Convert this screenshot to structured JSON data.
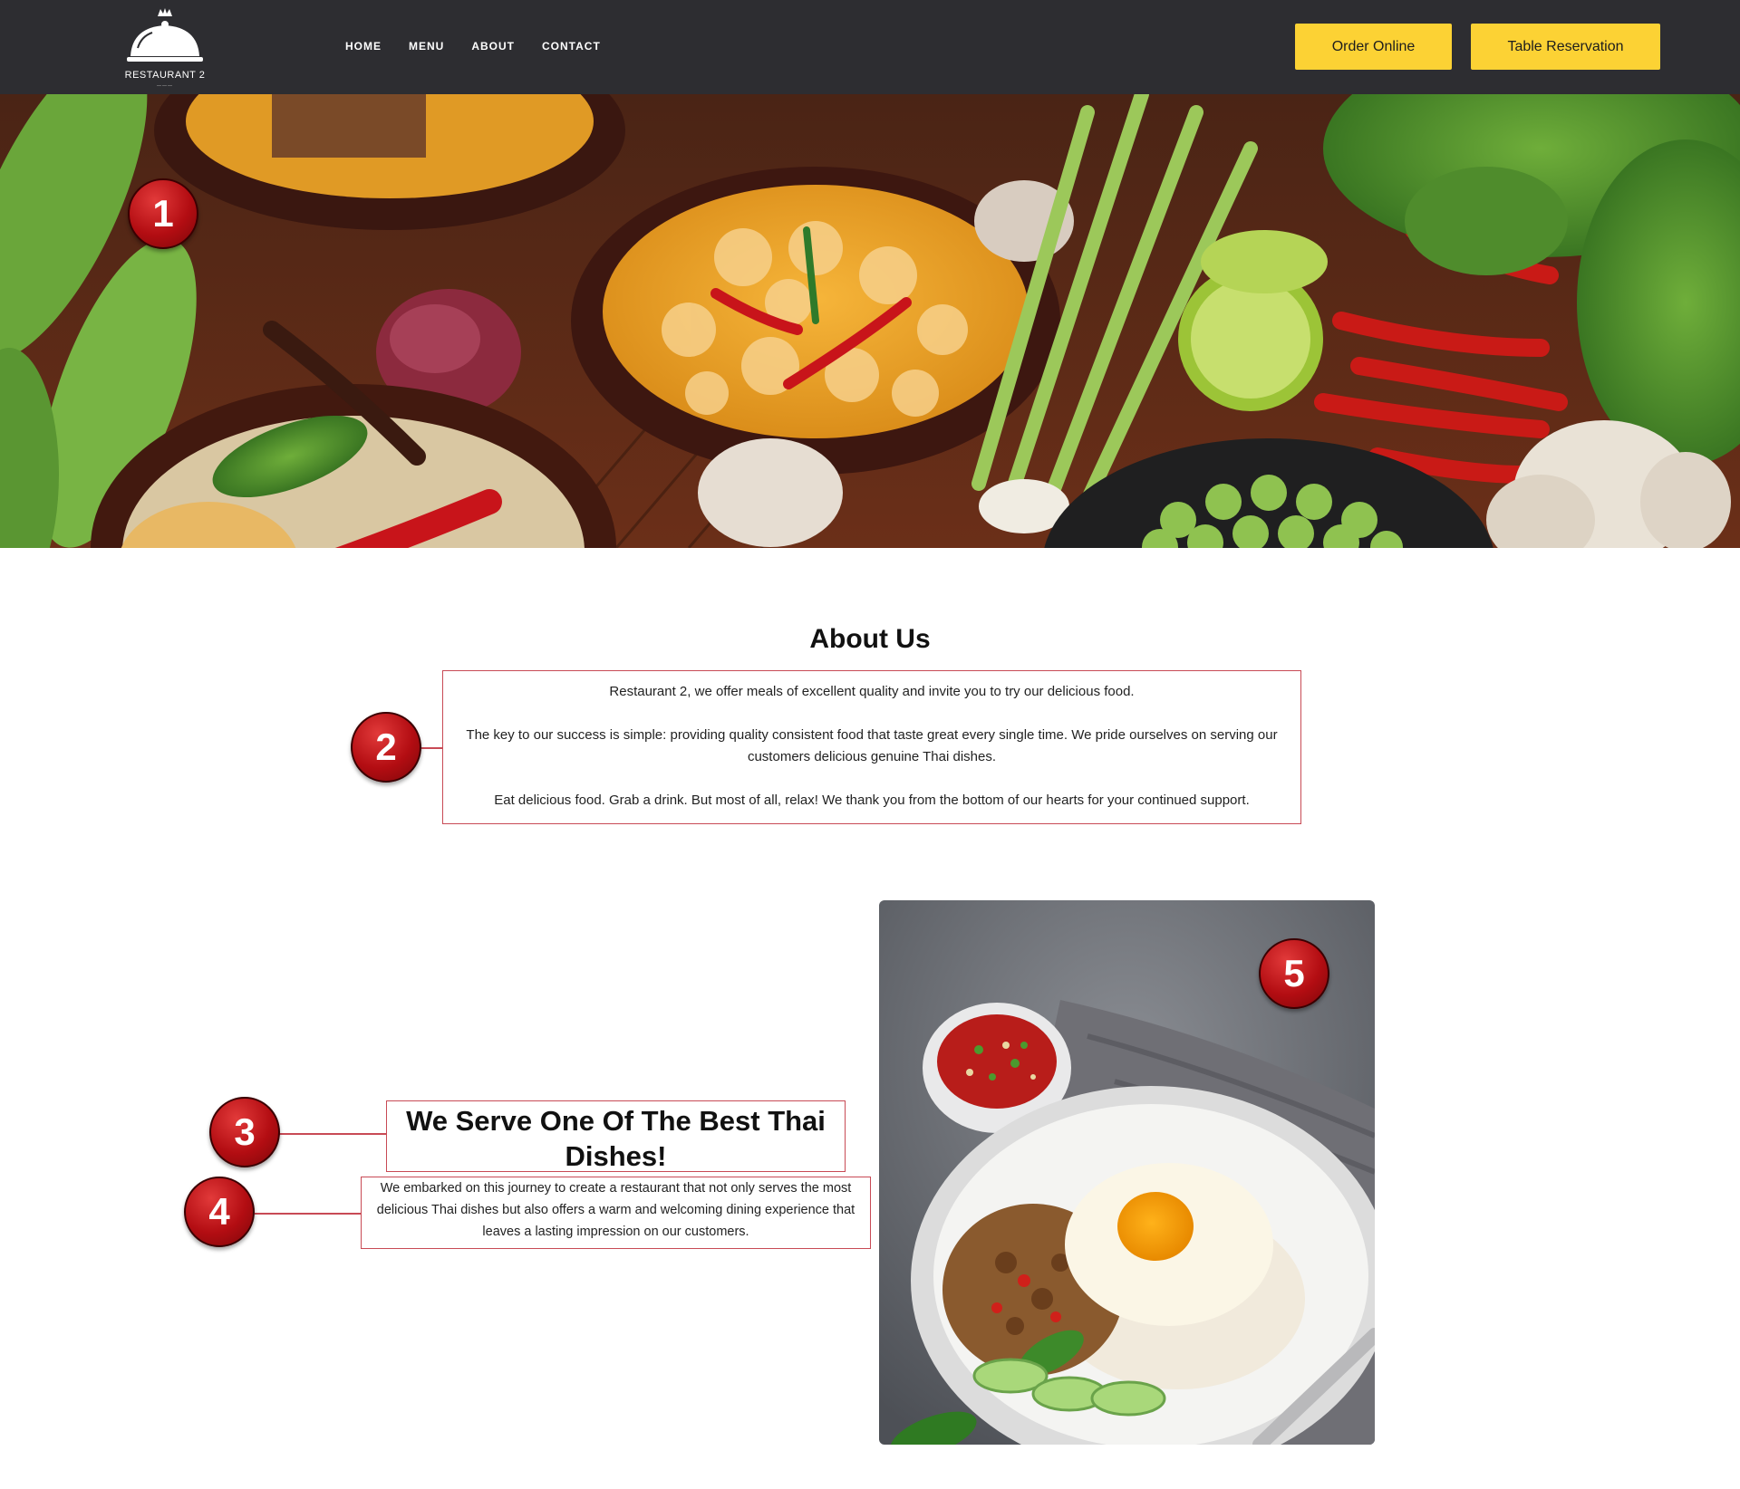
{
  "header": {
    "logo_text": "RESTAURANT 2",
    "nav": [
      {
        "label": "HOME"
      },
      {
        "label": "MENU"
      },
      {
        "label": "ABOUT"
      },
      {
        "label": "CONTACT"
      }
    ],
    "order_button": "Order Online",
    "reservation_button": "Table Reservation"
  },
  "about": {
    "title": "About Us",
    "paragraphs": [
      "Restaurant 2, we offer meals of excellent quality and invite you to try our delicious food.",
      "The key to our success is simple: providing quality consistent food that taste great every single time. We pride ourselves on serving our customers delicious genuine Thai dishes.",
      "Eat delicious food. Grab a drink. But most of all, relax! We thank you from the bottom of our hearts for your continued support."
    ]
  },
  "serve": {
    "heading": "We Serve One Of The Best Thai Dishes!",
    "text": "We embarked on this journey to create a restaurant that not only serves the most delicious Thai dishes but also offers a warm and welcoming dining experience that leaves a lasting impression on our customers."
  },
  "markers": [
    "1",
    "2",
    "3",
    "4",
    "5"
  ],
  "colors": {
    "header_bg": "#2d2d31",
    "button_bg": "#fcd234",
    "marker_red": "#b30d12",
    "outline_red": "#c84a55"
  }
}
